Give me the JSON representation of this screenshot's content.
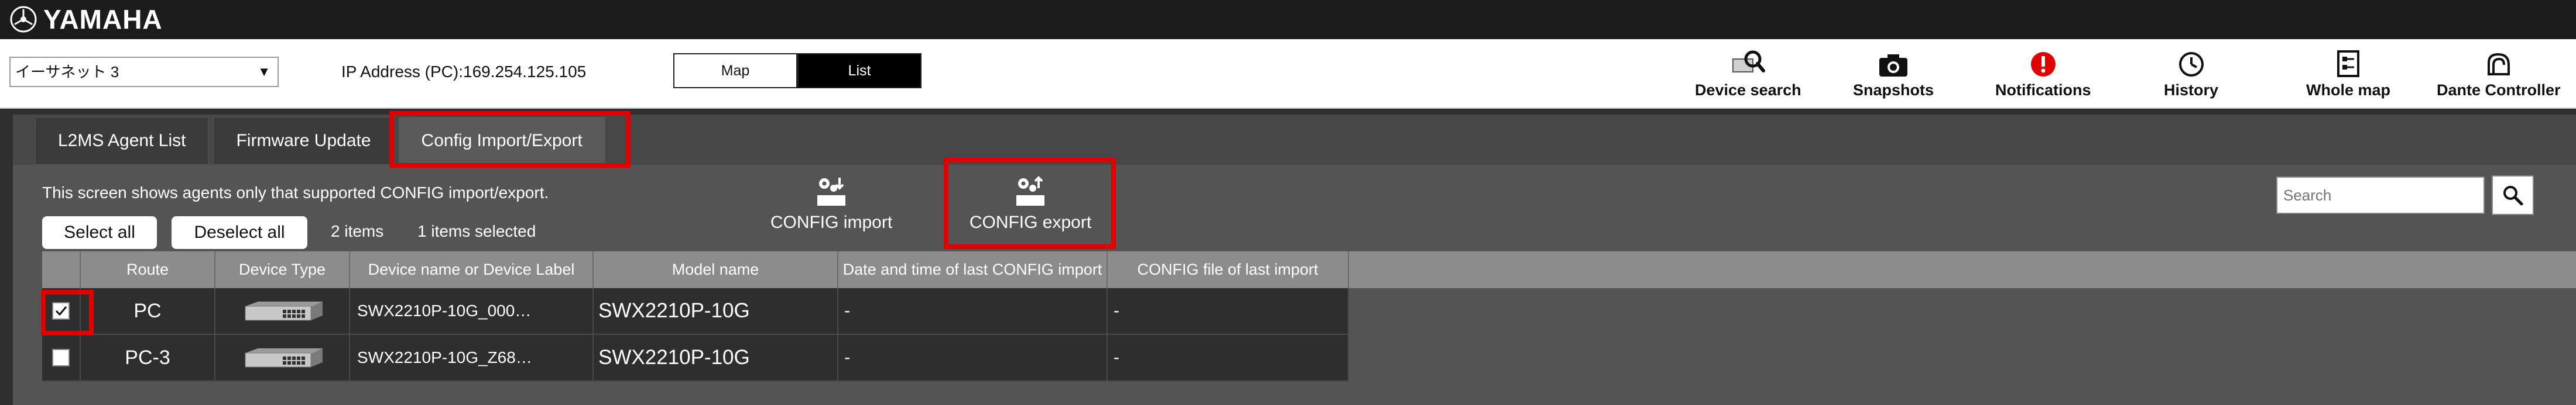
{
  "app": {
    "logo_text": "YAMAHA"
  },
  "toolbar": {
    "network_adapter": "イーサネット 3",
    "ip_address": "IP Address (PC):169.254.125.105",
    "view_map": "Map",
    "view_list": "List",
    "tools": [
      {
        "label": "Device search",
        "icon": "device-search-icon"
      },
      {
        "label": "Snapshots",
        "icon": "camera-icon"
      },
      {
        "label": "Notifications",
        "icon": "alert-icon"
      },
      {
        "label": "History",
        "icon": "history-icon"
      },
      {
        "label": "Whole map",
        "icon": "whole-map-icon"
      },
      {
        "label": "Dante Controller",
        "icon": "dante-icon"
      }
    ]
  },
  "tabs": [
    "L2MS Agent List",
    "Firmware Update",
    "Config Import/Export"
  ],
  "panel": {
    "description": "This screen shows agents only that supported CONFIG import/export.",
    "select_all": "Select all",
    "deselect_all": "Deselect all",
    "items_count": "2 items",
    "selected_count": "1 items selected",
    "config_import": "CONFIG import",
    "config_export": "CONFIG export",
    "search_placeholder": "Search"
  },
  "table": {
    "headers": [
      "Route",
      "Device Type",
      "Device name or Device Label",
      "Model name",
      "Date and time of last CONFIG import",
      "CONFIG file of last import"
    ],
    "rows": [
      {
        "checked": true,
        "route": "PC",
        "device_name": "SWX2210P-10G_000…",
        "model": "SWX2210P-10G",
        "last_import": "-",
        "last_file": "-"
      },
      {
        "checked": false,
        "route": "PC-3",
        "device_name": "SWX2210P-10G_Z68…",
        "model": "SWX2210P-10G",
        "last_import": "-",
        "last_file": "-"
      }
    ]
  },
  "colors": {
    "highlight": "#e00000",
    "titlebar": "#1b1b1b",
    "alert": "#e00000"
  }
}
